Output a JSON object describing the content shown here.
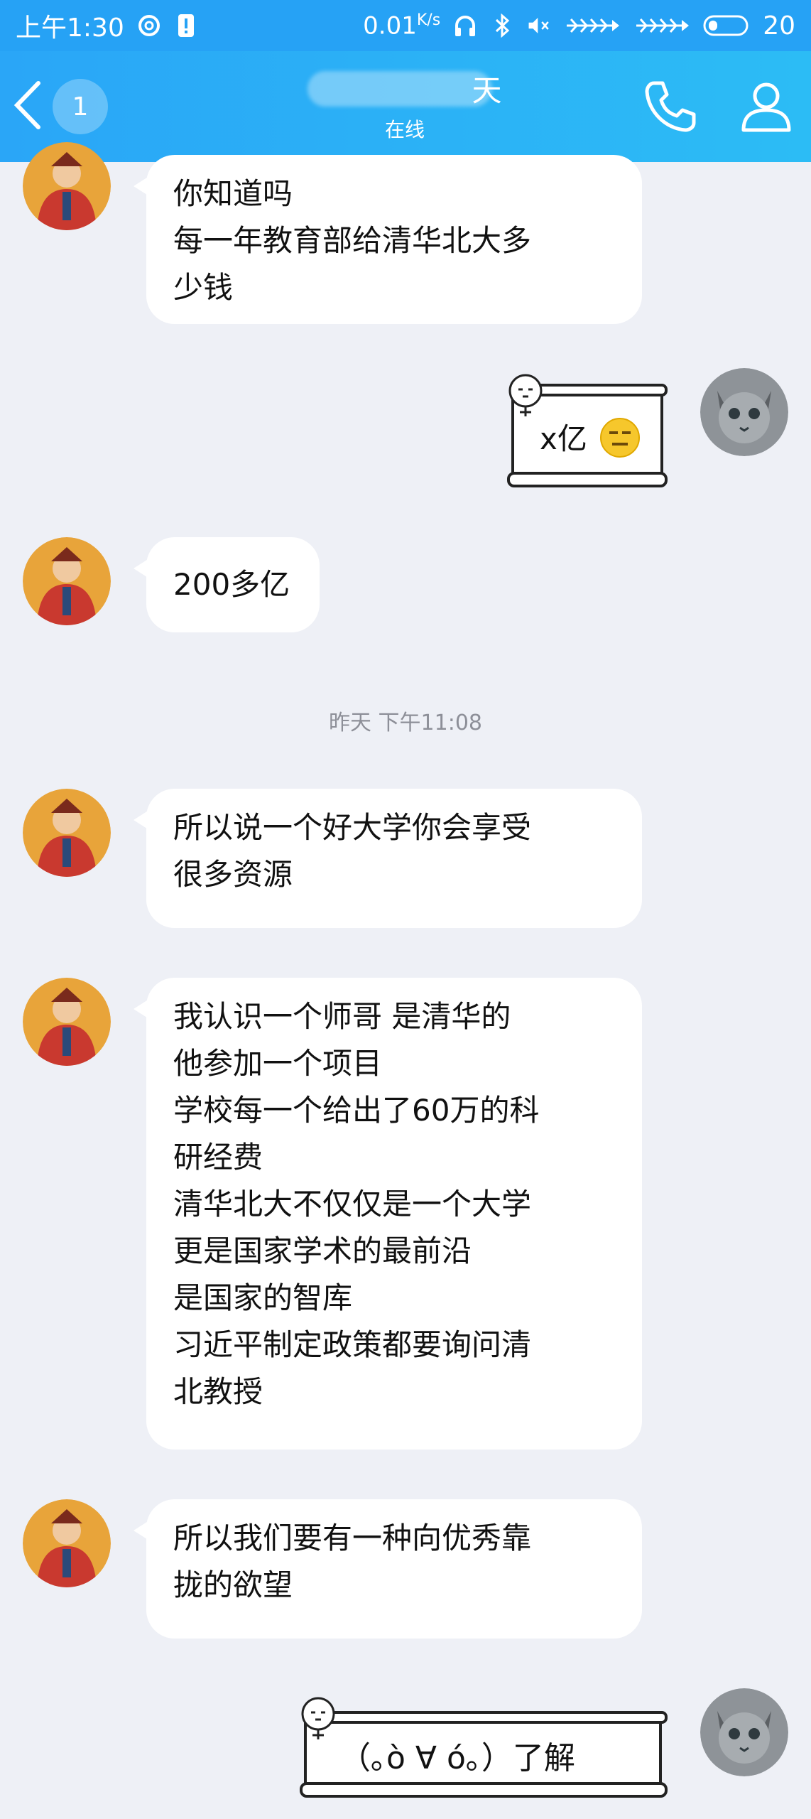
{
  "status_bar": {
    "time": "上午1:30",
    "speed_value": "0.01",
    "speed_unit": "K/s",
    "battery": "20",
    "icons": [
      "spiral-notification-icon",
      "sim-alert-icon",
      "headphones-icon",
      "bluetooth-icon",
      "mute-icon",
      "fishbone-signal-icon",
      "fishbone-signal-icon",
      "battery-icon"
    ]
  },
  "header": {
    "back_count": "1",
    "title_visible_char": "天",
    "status": "在线",
    "icons": [
      "back-arrow-icon",
      "phone-icon",
      "profile-icon"
    ]
  },
  "messages": [
    {
      "side": "left",
      "lines": [
        "你知道吗",
        "每一年教育部给清华北大多",
        "少钱"
      ]
    },
    {
      "side": "right",
      "type": "scroll",
      "text": "x亿",
      "emoji": "😑"
    },
    {
      "side": "left",
      "lines": [
        "200多亿"
      ]
    },
    {
      "type": "timestamp",
      "text": "昨天  下午11:08"
    },
    {
      "side": "left",
      "lines": [
        "所以说一个好大学你会享受",
        "很多资源"
      ]
    },
    {
      "side": "left",
      "lines": [
        "我认识一个师哥 是清华的",
        "他参加一个项目",
        "学校每一个给出了60万的科",
        "研经费",
        "清华北大不仅仅是一个大学",
        "更是国家学术的最前沿",
        "是国家的智库",
        "习近平制定政策都要询问清",
        "北教授"
      ]
    },
    {
      "side": "left",
      "lines": [
        "所以我们要有一种向优秀靠",
        "拢的欲望"
      ]
    },
    {
      "side": "right",
      "type": "scroll",
      "text": "（｡ò ∀ ó｡）了解"
    }
  ],
  "colors": {
    "header": "#2aa6f7",
    "background": "#eef0f6",
    "bubble": "#ffffff"
  }
}
